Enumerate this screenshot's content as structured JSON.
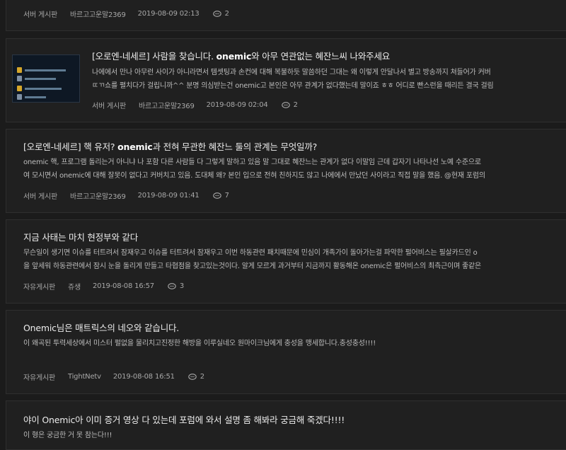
{
  "posts": [
    {
      "excerpt_lines": [],
      "board": "서버 게시판",
      "author": "바르고고운말2369",
      "date": "2019-08-09 02:13",
      "comments": "2"
    },
    {
      "title_a": "[오로엔-네세르] 사람을 찾습니다. ",
      "title_b": "onemic",
      "title_c": "와 아무 연관없는 혜잔느씨 나와주세요",
      "excerpt_lines": [
        "나에에서 만나 아무런 사이가 아니라면서 템셋팅과 손컨에 대해 복불하듯 말씀하던 그대는 왜 이렇게 안달나서 별고 방송까지 쳐들어가 커버",
        "ㄸㄲ쇼를 펼치다가 걸립니까^^ 분명 의심받는건 onemic고 본인은 아무 관계가 없다했는데 말이죠 ㅎㅎ 어디로 빤스런을 때리든 결국 걸림"
      ],
      "board": "서버 게시판",
      "author": "바르고고운말2369",
      "date": "2019-08-09 02:04",
      "comments": "2"
    },
    {
      "title_a": "[오로엔-네세르] 핵 유저? ",
      "title_b": "onemic",
      "title_c": "과 전혀 무관한 혜잔느 둘의 관계는 무엇일까?",
      "excerpt_lines": [
        "onemic 핵, 프로그램 돌리는거 아니냐 나 포함 다른 사람들 다 그렇게 말하고 있음 말 그대로 혜잔느는 관계가 없다 이말임 근데 갑자기 나타나선 노예 수준으로",
        "여 모시면서 onemic에 대해 잘못이 없다고 커버치고 있음. 도대체 왜? 본인 입으로 전혀 친하지도 않고 나에에서 만났던 사이라고 직접 말을 했음. @현재 포럼의"
      ],
      "board": "서버 게시판",
      "author": "바르고고운말2369",
      "date": "2019-08-09 01:41",
      "comments": "7"
    },
    {
      "title_a": "지금 사태는 마치 현정부와 같다",
      "title_b": "",
      "title_c": "",
      "excerpt_lines": [
        "무슨일이 생기면 이슈를 터트려서 잠재우고 이슈를 터트려서 잠재우고 이번 하동관련 패치때문에 민심이 개족가이 돌아가는걸 파악한 펄어비스는 필살카드인 o",
        "을 앞세워 하동관련에서 잠시 눈을 돌리게 만들고 타협점을 찾고있는것이다. 알게 모르게 과거부터 지금까지 활동해온 onemic은 펄어비스의 최측근이며 좋같은"
      ],
      "board": "자유게시판",
      "author": "쥬생",
      "date": "2019-08-08 16:57",
      "comments": "3"
    },
    {
      "title_a": "Onemic님은 매트릭스의 네오와 같습니다.",
      "title_b": "",
      "title_c": "",
      "excerpt_lines": [
        "이 왜곡된 투력세상에서 미스터 펄없을 물리치고진정한 해방을 이루실네오 원마이크님에게 충성을 맹세합니다.충성충성!!!!"
      ],
      "board": "자유게시판",
      "author": "TightNetv",
      "date": "2019-08-08 16:51",
      "comments": "2"
    },
    {
      "title_a": "야이 Onemic아 이미 증거 영상 다 있는데 포럼에 와서 설명 좀 해봐라 궁금해 죽겠다!!!!",
      "title_b": "",
      "title_c": "",
      "excerpt_lines": [
        "이 형은 궁금한 거 못 참는다!!!"
      ]
    }
  ],
  "colors": {
    "background": "#1b1b1b",
    "card": "#202020",
    "border": "#2f2f2f",
    "text": "#ececec",
    "meta": "#a8a8a8"
  },
  "icons": {
    "comment": "speech-bubble-icon"
  }
}
